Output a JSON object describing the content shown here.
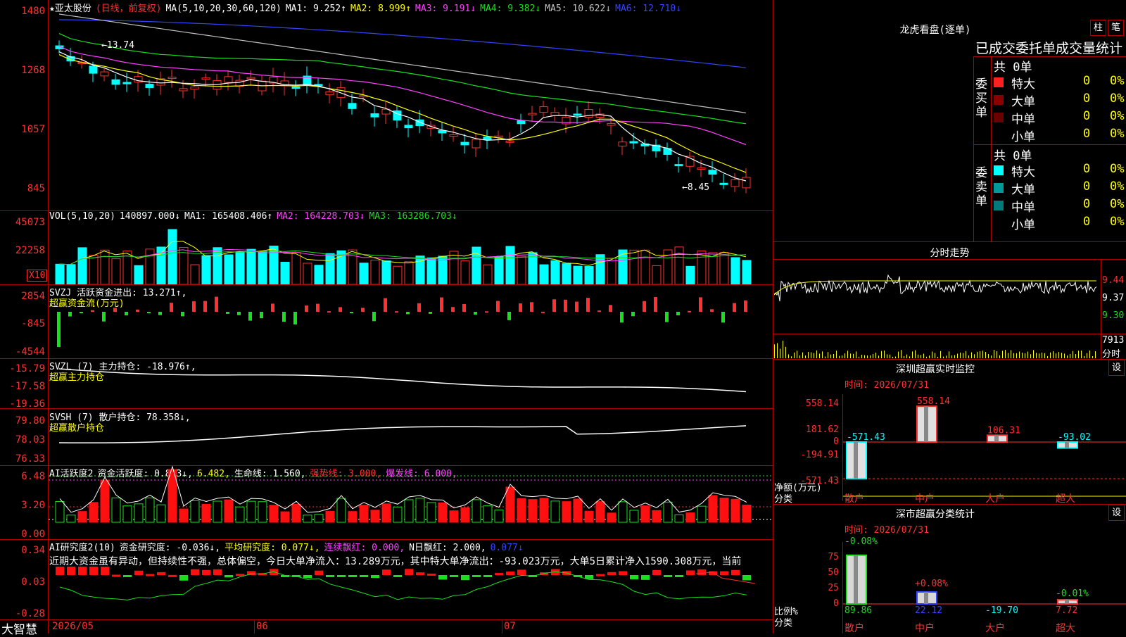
{
  "colors": {
    "up": "#ff3030",
    "down": "#00ffff",
    "ma1": "#ffffff",
    "ma2": "#ffff00",
    "ma3": "#ff40ff",
    "ma4": "#19e01e",
    "ma5": "#c0c0c0",
    "ma6": "#3344ff",
    "grid": "#b00000"
  },
  "main": {
    "stock_name": "★亚太股份",
    "period_label": "(日线，前复权)",
    "ma_label": "MA(5,10,20,30,60,120)",
    "ma1": "MA1: 9.252↑",
    "ma2": "MA2: 8.999↑",
    "ma3": "MA3: 9.191↓",
    "ma4": "MA4: 9.382↓",
    "ma5": "MA5: 10.622↓",
    "ma6": "MA6: 12.710↓",
    "y_ticks": [
      "1480",
      "1268",
      "1057",
      "845"
    ],
    "high_marker": "←13.74",
    "low_marker": "←8.45"
  },
  "vol": {
    "header": "VOL(5,10,20)",
    "value": "140897.000↓",
    "ma1": "MA1: 165408.406↑",
    "ma2": "MA2: 164228.703↓",
    "ma3": "MA3: 163286.703↓",
    "y_ticks": [
      "45073",
      "22258"
    ],
    "unit": "X10"
  },
  "svzj": {
    "header": "SVZJ  活跃资金进出: 13.271↑,",
    "sub": "超赢资金流(万元)",
    "y_ticks": [
      "2854",
      "-845",
      "-4544"
    ]
  },
  "svzl": {
    "header": "SVZL (7) 主力持仓: -18.976↑,",
    "sub": "超赢主力持仓",
    "y_ticks": [
      "-15.79",
      "-17.58",
      "-19.36"
    ]
  },
  "svsh": {
    "header": "SVSH (7) 散户持仓: 78.358↓,",
    "sub": "超赢散户持仓",
    "y_ticks": [
      "79.80",
      "78.03",
      "76.33"
    ]
  },
  "ai2": {
    "h1": "AI活跃度2",
    "h2": "资金活跃度: 0.883↓,",
    "h3": "6.482,",
    "h4": "生命线: 1.560,",
    "h5": "强势线: 3.000,",
    "h6": "爆发线: 6.000,",
    "y_ticks": [
      "6.48",
      "3.20",
      "0.00"
    ]
  },
  "ai_research": {
    "h1": "AI研究度2(10)",
    "h2": "资金研究度: -0.036↓,",
    "h3": "平均研究度: 0.077↓,",
    "h4": "连续飘红: 0.000,",
    "h5": "N日飘红: 2.000,",
    "h6": "0.077↓",
    "commentary": "近期大资金虽有异动，但持续性不强，总体偏空，今日大单净流入：13.289万元，其中特大单净流出：-93.023万元，大单5日累计净入1590.308万元，当前",
    "y_ticks": [
      "0.34",
      "0.03",
      "-0.28"
    ]
  },
  "footer": {
    "brand": "大智慧",
    "dates": [
      "2026/05",
      "06",
      "07"
    ]
  },
  "longhu": {
    "title": "龙虎看盘(逐单)",
    "btn_bar": "柱",
    "btn_line": "笔",
    "subtitle": "已成交委托单成交量统计",
    "buy_label": "委买单",
    "sell_label": "委卖单",
    "buy_total": "共 0单",
    "sell_total": "共 0单",
    "rows": [
      {
        "name": "特大",
        "count": "0",
        "pct": "0%",
        "color": "#ff2020"
      },
      {
        "name": "大单",
        "count": "0",
        "pct": "0%",
        "color": "#8a0000"
      },
      {
        "name": "中单",
        "count": "0",
        "pct": "0%",
        "color": "#6a0000"
      },
      {
        "name": "小单",
        "count": "0",
        "pct": "0%",
        "color": "#000000"
      }
    ],
    "sell_rows": [
      {
        "name": "特大",
        "count": "0",
        "pct": "0%",
        "color": "#00ffff"
      },
      {
        "name": "大单",
        "count": "0",
        "pct": "0%",
        "color": "#009a9a"
      },
      {
        "name": "中单",
        "count": "0",
        "pct": "0%",
        "color": "#007a7a"
      },
      {
        "name": "小单",
        "count": "0",
        "pct": "0%",
        "color": "#000000"
      }
    ]
  },
  "intraday": {
    "title": "分时走势",
    "prices": [
      "9.44",
      "9.37",
      "9.30"
    ],
    "vol": "7913",
    "vol_unit": "分时"
  },
  "sz_monitor": {
    "title": "深圳超赢实时监控",
    "btn": "设",
    "time": "时间: 2026/07/31",
    "y_ticks": [
      "558.14",
      "181.62",
      "0",
      "-194.91",
      "-571.43"
    ],
    "ylabel1": "净额(万元)",
    "ylabel2": "分类",
    "categories": [
      "散户",
      "中户",
      "大户",
      "超大"
    ],
    "values": [
      "-571.43",
      "558.14",
      "106.31",
      "-93.02"
    ]
  },
  "sz_class": {
    "title": "深市超赢分类统计",
    "btn": "设",
    "time": "时间: 2026/07/31",
    "y_ticks": [
      "75",
      "50",
      "25",
      "0"
    ],
    "ylabel1": "比例%",
    "ylabel2": "分类",
    "categories": [
      "散户",
      "中户",
      "大户",
      "超大"
    ],
    "top_vals": [
      "-0.08%",
      "+0.08%",
      "",
      "-0.01%"
    ],
    "bottom_vals": [
      "89.86",
      "22.12",
      "-19.70",
      "7.72"
    ]
  }
}
